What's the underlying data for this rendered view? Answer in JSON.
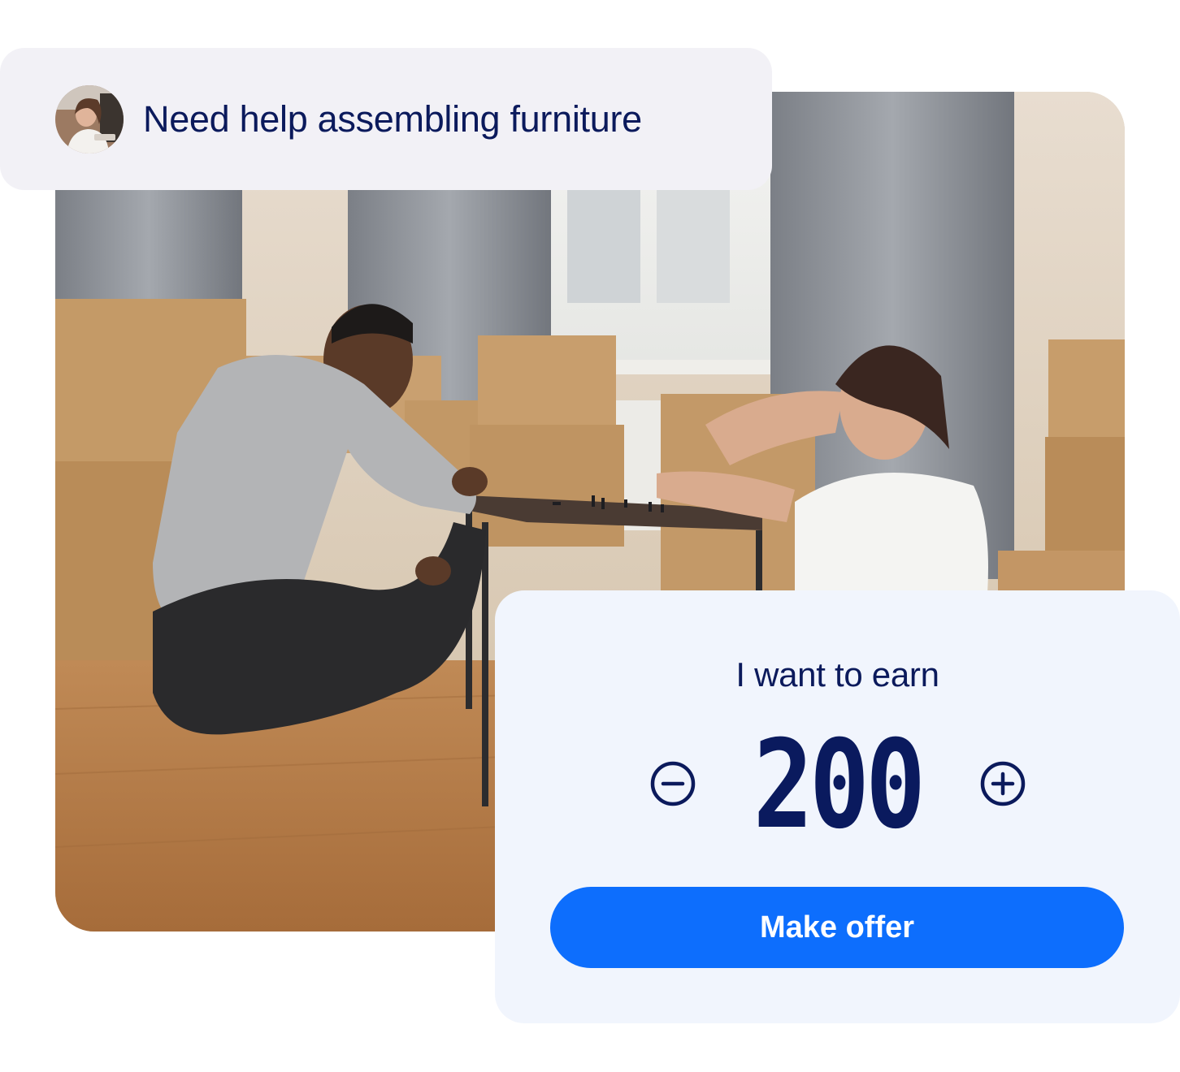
{
  "request": {
    "title": "Need help assembling furniture",
    "avatar": "user-avatar"
  },
  "offer": {
    "label": "I want to earn",
    "amount": "200",
    "decrease_icon": "minus-circle-icon",
    "increase_icon": "plus-circle-icon",
    "button_label": "Make offer"
  },
  "colors": {
    "text_primary": "#0b1a5c",
    "button_bg": "#0d6efd",
    "card_bg": "#f1f5fd",
    "bubble_bg": "#f2f1f6"
  }
}
